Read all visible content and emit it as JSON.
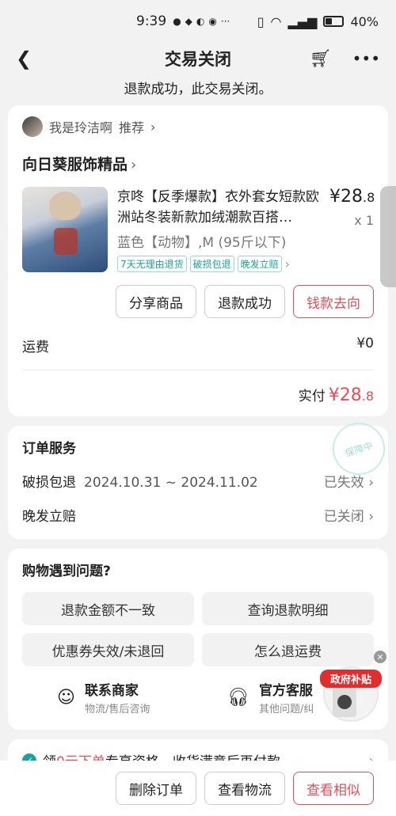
{
  "status_bar": {
    "time": "9:39",
    "battery": "40%",
    "dots": "···"
  },
  "nav": {
    "title": "交易关闭"
  },
  "subtitle": "退款成功，此交易关闭。",
  "seller": {
    "name": "我是玲洁啊",
    "recommend": "推荐"
  },
  "store": {
    "name": "向日葵服饰精品"
  },
  "product": {
    "title": "京咚【反季爆款】衣外套女短款欧洲站冬装新款加绒潮款百搭…",
    "spec": "蓝色【动物】,M (95斤以下)",
    "price_int": "¥28",
    "price_dec": ".8",
    "qty": "x 1",
    "tags": [
      "7天无理由退货",
      "破损包退",
      "晚发立赔"
    ]
  },
  "actions": {
    "share": "分享商品",
    "refund_status": "退款成功",
    "money_flow": "钱款去向"
  },
  "fee": {
    "label": "运费",
    "value": "¥0"
  },
  "paid": {
    "label": "实付",
    "int": "¥28",
    "dec": ".8"
  },
  "service": {
    "title": "订单服务",
    "stamp": "保障中",
    "items": [
      {
        "name": "破损包退",
        "date": "2024.10.31 ~ 2024.11.02",
        "status": "已失效"
      },
      {
        "name": "晚发立赔",
        "date": "",
        "status": "已关闭"
      }
    ]
  },
  "problems": {
    "title": "购物遇到问题?",
    "buttons": [
      "退款金额不一致",
      "查询退款明细",
      "优惠券失效/未退回",
      "怎么退运费"
    ],
    "contacts": [
      {
        "title": "联系商家",
        "sub": "物流/售后咨询"
      },
      {
        "title": "官方客服",
        "sub": "其他问题/纠"
      }
    ]
  },
  "promo": {
    "pre": "领",
    "hl": "0元下单",
    "post": "专享资格，收货满意后再付款"
  },
  "float_ad": {
    "label": "政府补贴"
  },
  "bottom": {
    "delete": "删除订单",
    "logistics": "查看物流",
    "similar": "查看相似"
  },
  "colors": {
    "accent_red": "#e0505a",
    "teal": "#1aa39a"
  }
}
